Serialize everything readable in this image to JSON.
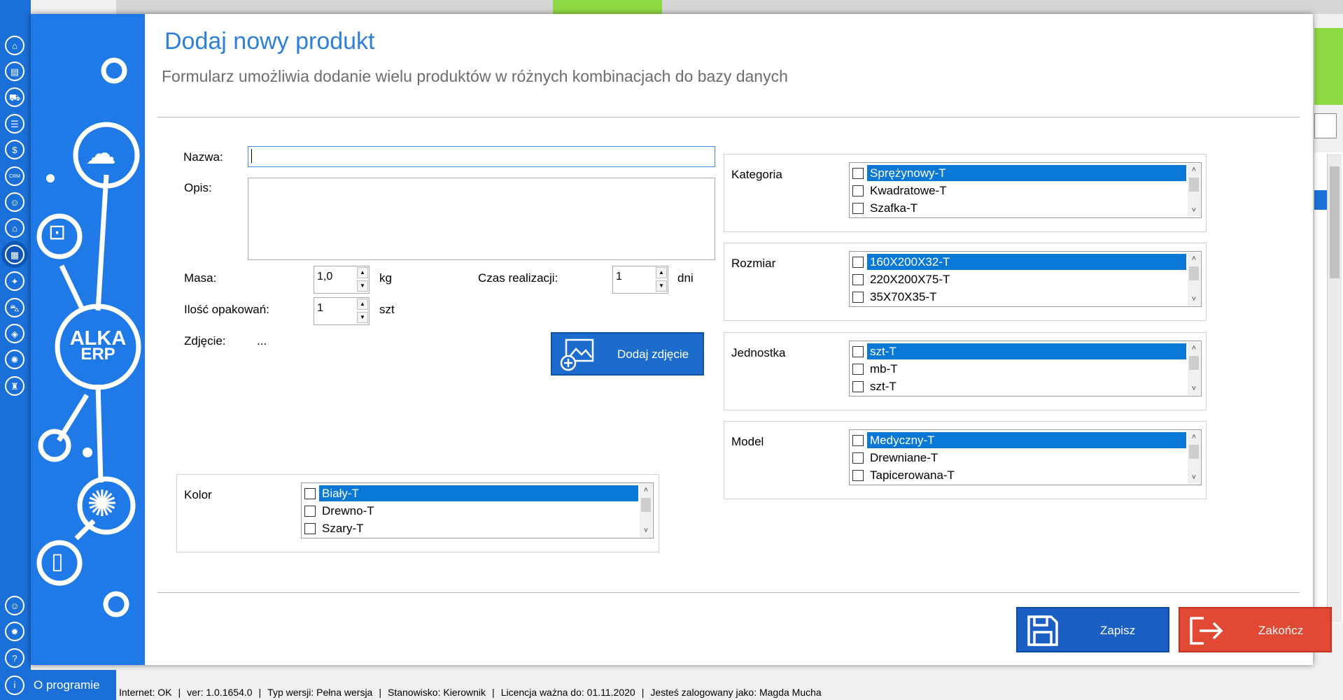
{
  "dialog": {
    "title": "Dodaj nowy produkt",
    "subtitle": "Formularz umożliwia dodanie wielu produktów w różnych kombinacjach do bazy danych"
  },
  "brand": {
    "line1": "ALKA",
    "line2": "ERP"
  },
  "form": {
    "nazwa_label": "Nazwa:",
    "nazwa_value": "",
    "opis_label": "Opis:",
    "opis_value": "",
    "masa_label": "Masa:",
    "masa_value": "1,0",
    "masa_unit": "kg",
    "ilosc_label": "Ilość opakowań:",
    "ilosc_value": "1",
    "ilosc_unit": "szt",
    "czas_label": "Czas realizacji:",
    "czas_value": "1",
    "czas_unit": "dni",
    "zdjecie_label": "Zdjęcie:",
    "zdjecie_value": "...",
    "add_photo_label": "Dodaj zdjęcie"
  },
  "groups": {
    "kategoria": {
      "label": "Kategoria",
      "items": [
        "Sprężynowy-T",
        "Kwadratowe-T",
        "Szafka-T"
      ]
    },
    "rozmiar": {
      "label": "Rozmiar",
      "items": [
        "160X200X32-T",
        "220X200X75-T",
        "35X70X35-T"
      ]
    },
    "jednostka": {
      "label": "Jednostka",
      "items": [
        "szt-T",
        "mb-T",
        "szt-T"
      ]
    },
    "model": {
      "label": "Model",
      "items": [
        "Medyczny-T",
        "Drewniane-T",
        "Tapicerowana-T"
      ]
    },
    "kolor": {
      "label": "Kolor",
      "items": [
        "Biały-T",
        "Drewno-T",
        "Szary-T"
      ]
    }
  },
  "actions": {
    "save_label": "Zapisz",
    "close_label": "Zakończ"
  },
  "app": {
    "about_label": "O programie"
  },
  "status_bar": {
    "internet": "Internet: OK",
    "version": "ver: 1.0.1654.0",
    "edition": "Typ wersji: Pełna wersja",
    "station": "Stanowisko: Kierownik",
    "license": "Licencja ważna do: 01.11.2020",
    "user": "Jesteś zalogowany jako: Magda Mucha"
  },
  "colors": {
    "accent": "#1f7ae8",
    "title": "#2d7fd8",
    "save": "#1c5fc4",
    "close": "#e14934",
    "selection": "#0a78d7"
  }
}
